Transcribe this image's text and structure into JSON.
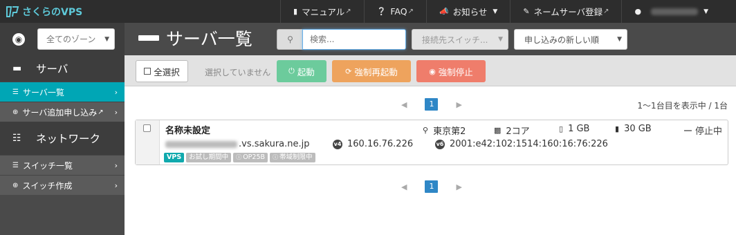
{
  "nav": {
    "brand": "さくらのVPS",
    "manual": "マニュアル",
    "faq": "FAQ",
    "notice": "お知らせ",
    "nameserver": "ネームサーバ登録",
    "ext_icon": "external-link-icon"
  },
  "sidebar": {
    "zone_select": "全てのゾーン",
    "server_section": "サーバ",
    "items_server": [
      {
        "label": "サーバ一覧"
      },
      {
        "label": "サーバ追加申し込み"
      }
    ],
    "network_section": "ネットワーク",
    "items_network": [
      {
        "label": "スイッチ一覧"
      },
      {
        "label": "スイッチ作成"
      }
    ]
  },
  "header": {
    "title": "サーバ一覧",
    "search_placeholder": "検索...",
    "switch_select": "接続先スイッチ...",
    "sort_select": "申し込みの新しい順"
  },
  "toolbar": {
    "select_all": "全選択",
    "none_selected": "選択していません",
    "start": "起動",
    "force_restart": "強制再起動",
    "force_stop": "強制停止"
  },
  "pagination": {
    "current_page": "1",
    "range_text": "1〜1台目を表示中 / 1台"
  },
  "server": {
    "name": "名称未設定",
    "zone": "東京第2",
    "cpu": "2コア",
    "memory": "1 GB",
    "storage": "30 GB",
    "status": "停止中",
    "hostname_suffix": ".vs.sakura.ne.jp",
    "ipv4_badge": "v4",
    "ipv4": "160.16.76.226",
    "ipv6_badge": "v6",
    "ipv6": "2001:e42:102:1514:160:16:76:226",
    "tags": [
      "VPS",
      "お試し期間中",
      "OP25B",
      "帯域制限中"
    ]
  },
  "colors": {
    "brand": "#5ec9d9",
    "active_sidebar": "#00a6b5",
    "start": "#6ccb9c",
    "restart": "#eea35d",
    "stop": "#ef7d6b",
    "page_active": "#2f87c6"
  }
}
